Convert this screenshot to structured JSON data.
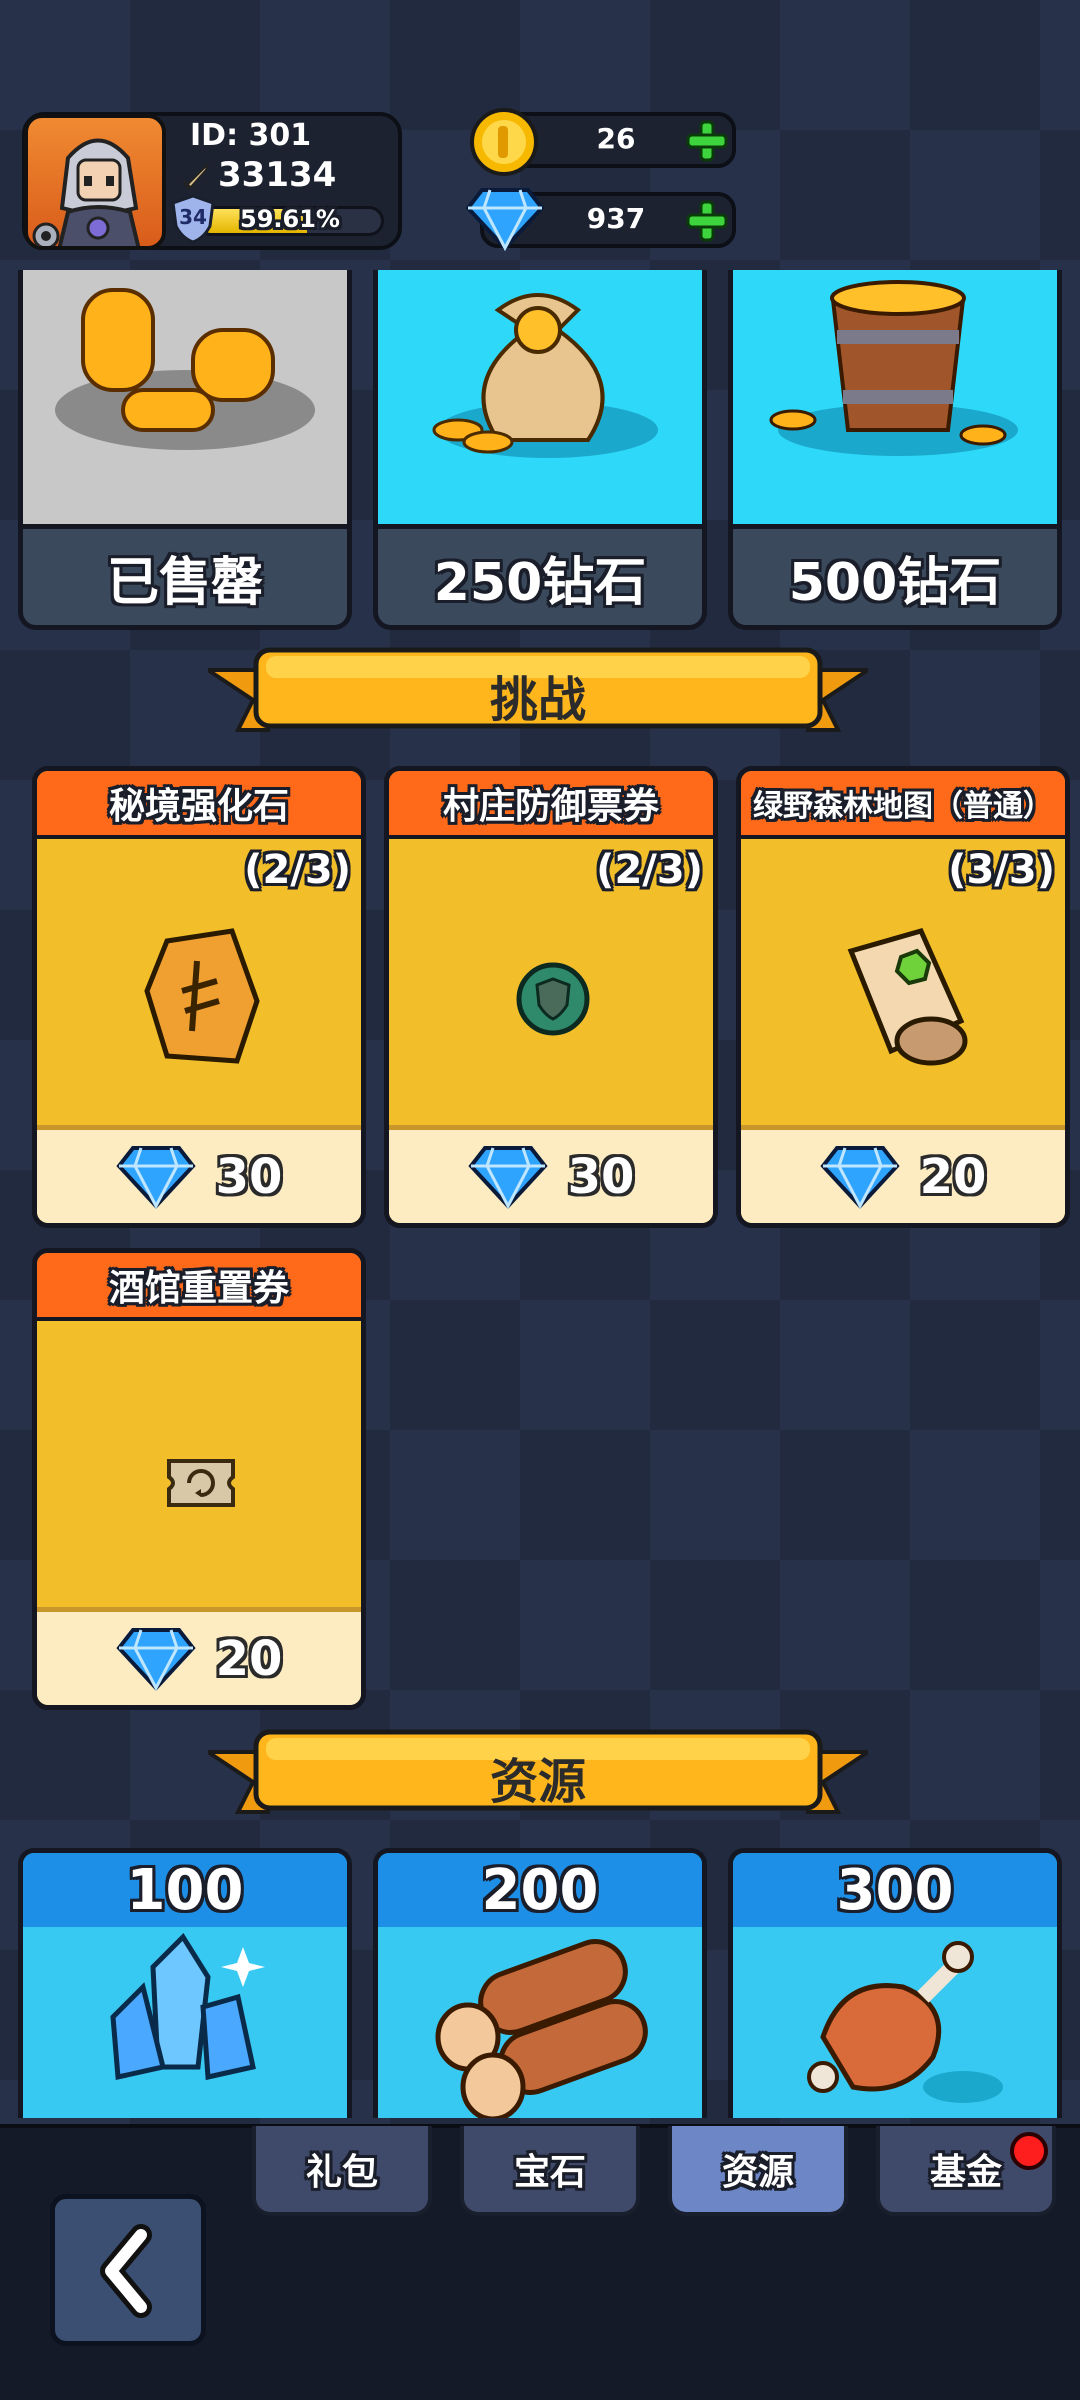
{
  "player": {
    "id": "ID: 301",
    "power": "33134",
    "level": "34",
    "xp_percent": "59.61%",
    "xp_fraction": 0.5961
  },
  "currency": {
    "gold": "26",
    "diamond": "937"
  },
  "top_offers": [
    {
      "label": "已售罄",
      "icon": "gold-stacks-icon",
      "bg": "#c8c8c8",
      "sold_out": true
    },
    {
      "label": "250钻石",
      "icon": "gold-sack-icon",
      "bg": "#2ed8f8",
      "sold_out": false
    },
    {
      "label": "500钻石",
      "icon": "gold-bucket-icon",
      "bg": "#2ed8f8",
      "sold_out": false
    }
  ],
  "sections": {
    "challenge": "挑战",
    "resources": "资源"
  },
  "challenge_items": [
    {
      "title": "秘境强化石",
      "count": "(2/3)",
      "price": "30",
      "icon": "rune-stone-icon"
    },
    {
      "title": "村庄防御票券",
      "count": "(2/3)",
      "price": "30",
      "icon": "shield-token-icon"
    },
    {
      "title": "绿野森林地图（普通）",
      "count": "(3/3)",
      "price": "20",
      "icon": "map-scroll-icon"
    },
    {
      "title": "酒馆重置券",
      "count": "",
      "price": "20",
      "icon": "reset-ticket-icon"
    }
  ],
  "resource_items": [
    {
      "amount": "100",
      "icon": "crystal-icon"
    },
    {
      "amount": "200",
      "icon": "wood-logs-icon"
    },
    {
      "amount": "300",
      "icon": "meat-icon"
    }
  ],
  "tabs": [
    "礼包",
    "宝石",
    "资源",
    "基金"
  ],
  "active_tab": "资源",
  "colors": {
    "accent_orange": "#ff6a1a",
    "card_yellow": "#f2bf2a",
    "sky_blue": "#2ed8f8",
    "tab_active": "#6d86c6"
  }
}
